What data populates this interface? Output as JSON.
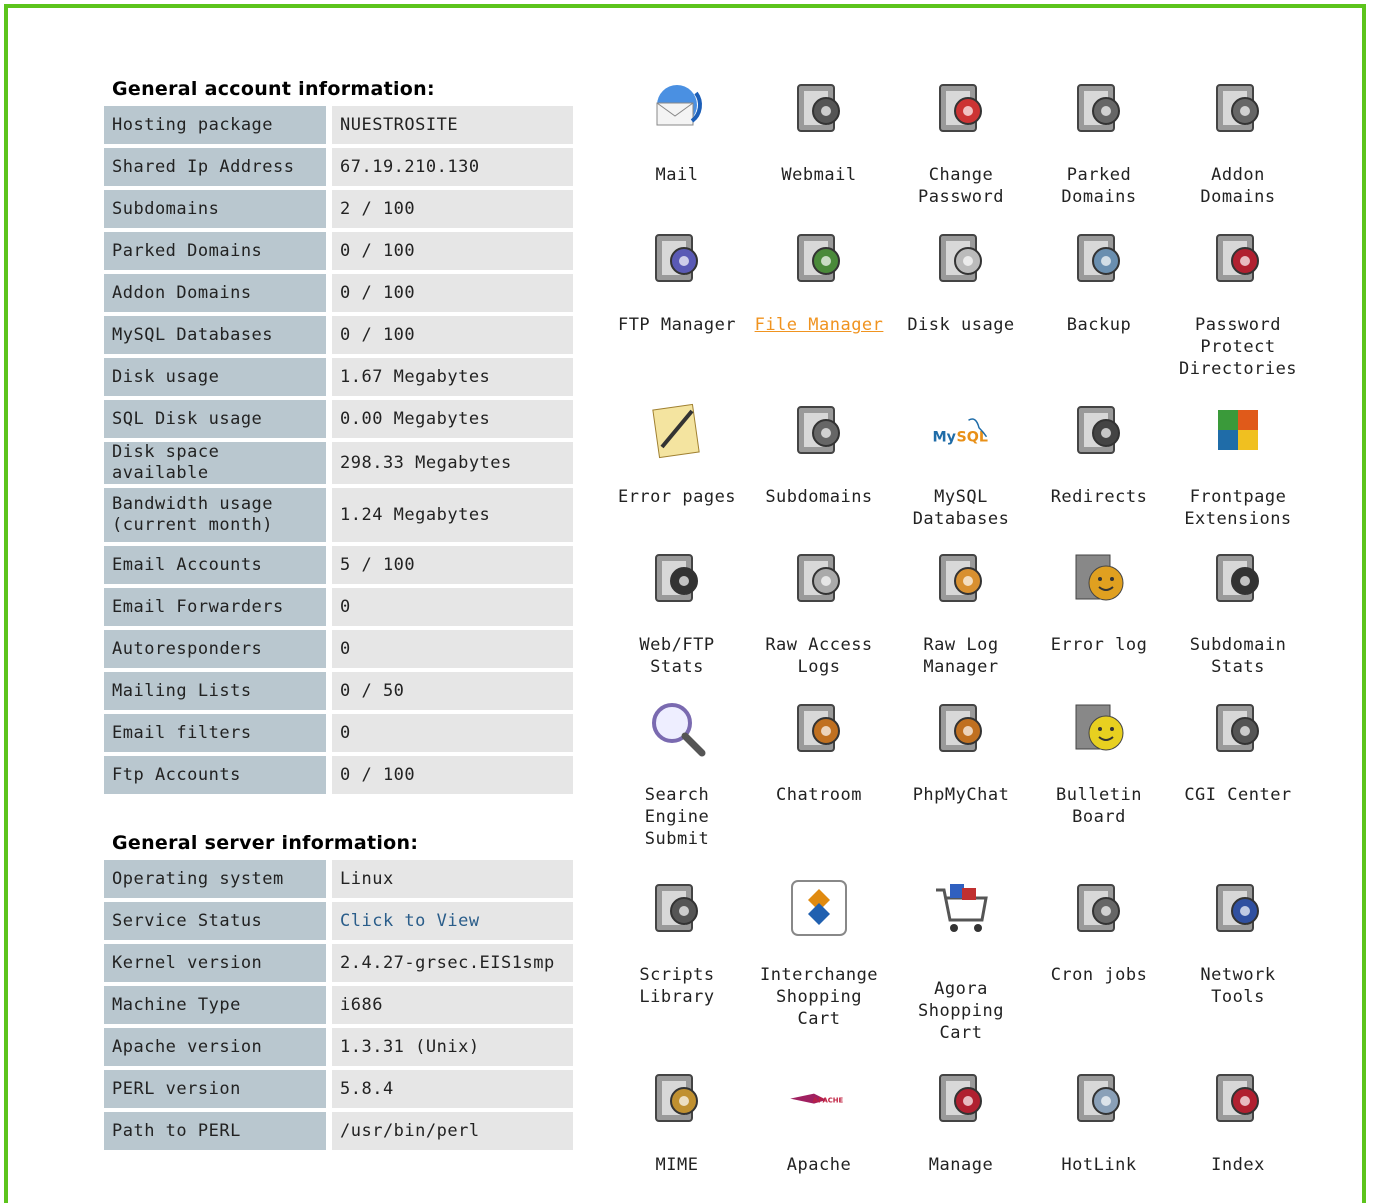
{
  "account": {
    "title": "General account information:",
    "rows": [
      {
        "key": "Hosting package",
        "value": "NUESTROSITE"
      },
      {
        "key": "Shared Ip Address",
        "value": "67.19.210.130"
      },
      {
        "key": "Subdomains",
        "value": "2 / 100"
      },
      {
        "key": "Parked Domains",
        "value": "0 / 100"
      },
      {
        "key": "Addon Domains",
        "value": "0 / 100"
      },
      {
        "key": "MySQL Databases",
        "value": "0 / 100"
      },
      {
        "key": "Disk usage",
        "value": "1.67 Megabytes"
      },
      {
        "key": "SQL Disk usage",
        "value": "0.00 Megabytes"
      },
      {
        "key": "Disk space available",
        "value": "298.33 Megabytes"
      },
      {
        "key": "Bandwidth usage (current month)",
        "value": "1.24 Megabytes"
      },
      {
        "key": "Email Accounts",
        "value": "5 / 100"
      },
      {
        "key": "Email Forwarders",
        "value": "0"
      },
      {
        "key": "Autoresponders",
        "value": "0"
      },
      {
        "key": "Mailing Lists",
        "value": "0 / 50"
      },
      {
        "key": "Email filters",
        "value": "0"
      },
      {
        "key": "Ftp Accounts",
        "value": "0 / 100"
      }
    ]
  },
  "server": {
    "title": "General server information:",
    "rows": [
      {
        "key": "Operating system",
        "value": "Linux"
      },
      {
        "key": "Service Status",
        "value": "Click to View",
        "link": true
      },
      {
        "key": "Kernel version",
        "value": "2.4.27-grsec.EIS1smp"
      },
      {
        "key": "Machine Type",
        "value": "i686"
      },
      {
        "key": "Apache version",
        "value": "1.3.31 (Unix)"
      },
      {
        "key": "PERL version",
        "value": "5.8.4"
      },
      {
        "key": "Path to PERL",
        "value": "/usr/bin/perl"
      }
    ]
  },
  "icons": [
    {
      "label": "Mail",
      "icon": "mail-icon",
      "color": "#3a7bd5"
    },
    {
      "label": "Webmail",
      "icon": "webmail-icon",
      "color": "#555"
    },
    {
      "label": "Change Password",
      "icon": "change-password-icon",
      "color": "#c33"
    },
    {
      "label": "Parked Domains",
      "icon": "parked-domains-icon",
      "color": "#666"
    },
    {
      "label": "Addon Domains",
      "icon": "addon-domains-icon",
      "color": "#666"
    },
    {
      "label": "FTP Manager",
      "icon": "ftp-manager-icon",
      "color": "#5a5ab5"
    },
    {
      "label": "File Manager",
      "icon": "file-manager-icon",
      "color": "#4a8a3a",
      "active": true
    },
    {
      "label": "Disk usage",
      "icon": "disk-usage-icon",
      "color": "#bbb"
    },
    {
      "label": "Backup",
      "icon": "backup-icon",
      "color": "#6a8fb0"
    },
    {
      "label": "Password Protect Directories",
      "icon": "password-protect-icon",
      "color": "#b02030"
    },
    {
      "label": "Error pages",
      "icon": "error-pages-icon",
      "color": "#d8b040"
    },
    {
      "label": "Subdomains",
      "icon": "subdomains-icon",
      "color": "#666"
    },
    {
      "label": "MySQL Databases",
      "icon": "mysql-icon",
      "color": "#1f6ca8"
    },
    {
      "label": "Redirects",
      "icon": "redirects-icon",
      "color": "#444"
    },
    {
      "label": "Frontpage Extensions",
      "icon": "frontpage-icon",
      "color": "#e05a1a"
    },
    {
      "label": "Web/FTP Stats",
      "icon": "web-ftp-stats-icon",
      "color": "#333"
    },
    {
      "label": "Raw Access Logs",
      "icon": "raw-access-logs-icon",
      "color": "#aaa"
    },
    {
      "label": "Raw Log Manager",
      "icon": "raw-log-manager-icon",
      "color": "#d89030"
    },
    {
      "label": "Error log",
      "icon": "error-log-icon",
      "color": "#e0a020"
    },
    {
      "label": "Subdomain Stats",
      "icon": "subdomain-stats-icon",
      "color": "#333"
    },
    {
      "label": "Search Engine Submit",
      "icon": "search-engine-icon",
      "color": "#7a6ab0"
    },
    {
      "label": "Chatroom",
      "icon": "chatroom-icon",
      "color": "#c07020"
    },
    {
      "label": "PhpMyChat",
      "icon": "phpmychat-icon",
      "color": "#c07020"
    },
    {
      "label": "Bulletin Board",
      "icon": "bulletin-board-icon",
      "color": "#e8d020"
    },
    {
      "label": "CGI Center",
      "icon": "cgi-center-icon",
      "color": "#555"
    },
    {
      "label": "Scripts Library",
      "icon": "scripts-library-icon",
      "color": "#555"
    },
    {
      "label": "Interchange Shopping Cart",
      "icon": "interchange-cart-icon",
      "color": "#e08a10"
    },
    {
      "label": "Agora Shopping Cart",
      "icon": "agora-cart-icon",
      "color": "#3060c0"
    },
    {
      "label": "Cron jobs",
      "icon": "cron-jobs-icon",
      "color": "#666"
    },
    {
      "label": "Network Tools",
      "icon": "network-tools-icon",
      "color": "#3050a0"
    },
    {
      "label": "MIME",
      "icon": "mime-icon",
      "color": "#c09030"
    },
    {
      "label": "Apache",
      "icon": "apache-icon",
      "color": "#a02060"
    },
    {
      "label": "Manage",
      "icon": "manage-icon",
      "color": "#b02030"
    },
    {
      "label": "HotLink",
      "icon": "hotlink-icon",
      "color": "#8aa0b8"
    },
    {
      "label": "Index",
      "icon": "index-icon",
      "color": "#b02030"
    }
  ]
}
